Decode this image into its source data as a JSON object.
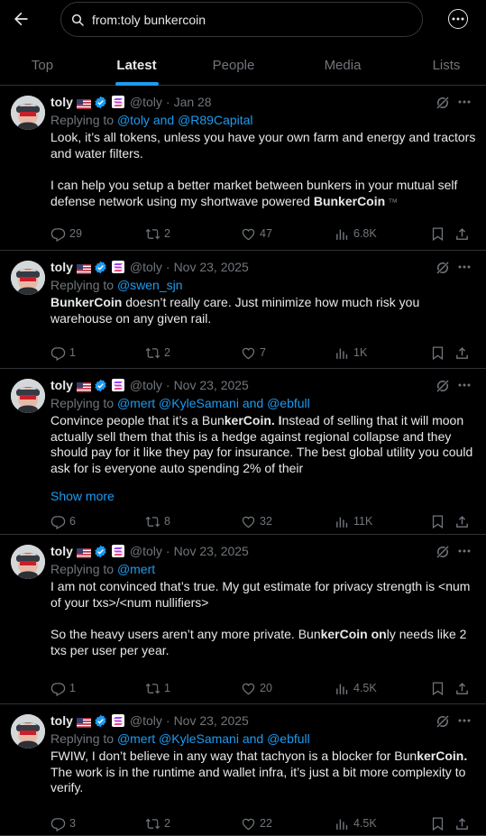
{
  "search": {
    "query": "from:toly bunkercoin"
  },
  "tabs": [
    {
      "label": "Top"
    },
    {
      "label": "Latest"
    },
    {
      "label": "People"
    },
    {
      "label": "Media"
    },
    {
      "label": "Lists"
    }
  ],
  "active_tab": "Latest",
  "icons": {
    "back": "arrow-left-icon",
    "search": "search-icon",
    "more": "more-circle-icon",
    "verified": "verified-badge-icon",
    "grok": "grok-icon",
    "reply": "reply-icon",
    "retweet": "retweet-icon",
    "like": "heart-icon",
    "views": "views-icon",
    "bookmark": "bookmark-icon",
    "share": "share-icon"
  },
  "colors": {
    "accent": "#1d9bf0",
    "background": "#000000",
    "muted": "#71767b",
    "text": "#e7e9ea"
  },
  "tweets": [
    {
      "name": "toly",
      "handle": "@toly",
      "sep": "·",
      "date": "Jan 28",
      "replying_prefix": "Replying to ",
      "replying_to": "@toly and @R89Capital",
      "paragraphs": [
        {
          "text": "Look, it’s all tokens, unless you have your own farm and energy and tractors and water filters."
        },
        {
          "text": ""
        },
        {
          "text": "I can help you setup a better market between bunkers in your mutual self defense network using my shortwave powered ",
          "bold": "BunkerCoin",
          "after": " ™"
        }
      ],
      "stats": {
        "replies": "29",
        "reposts": "2",
        "likes": "47",
        "views": "6.8K"
      }
    },
    {
      "name": "toly",
      "handle": "@toly",
      "sep": "·",
      "date": "Nov 23, 2025",
      "replying_prefix": "Replying to ",
      "replying_to": "@swen_sjn",
      "paragraphs": [
        {
          "bold_lead": "BunkerCoin",
          "text": " doesn’t really care. Just minimize how much risk you warehouse on any given rail."
        }
      ],
      "stats": {
        "replies": "1",
        "reposts": "2",
        "likes": "7",
        "views": "1K"
      }
    },
    {
      "name": "toly",
      "handle": "@toly",
      "sep": "·",
      "date": "Nov 23, 2025",
      "replying_prefix": "Replying to ",
      "replying_to": "@mert @KyleSamani and @ebfull",
      "paragraphs": [
        {
          "text": "Convince people that it’s a Bun",
          "bold": "kerCoin. I",
          "after": "nstead of selling that it will moon actually sell them that this is a hedge against regional collapse and they should pay for it like they pay for insurance.  The best global utility you could ask for is everyone auto spending 2% of their"
        }
      ],
      "show_more": "Show more",
      "stats": {
        "replies": "6",
        "reposts": "8",
        "likes": "32",
        "views": "11K"
      }
    },
    {
      "name": "toly",
      "handle": "@toly",
      "sep": "·",
      "date": "Nov 23, 2025",
      "replying_prefix": "Replying to ",
      "replying_to": "@mert",
      "paragraphs": [
        {
          "text": "I am not convinced that’s true.  My gut estimate for privacy strength is <num of your txs>/<num nullifiers>"
        },
        {
          "text": ""
        },
        {
          "text": "So the heavy users aren’t any more private.  Bun",
          "bold": "kerCoin on",
          "after": "ly needs like 2 txs per user per year."
        }
      ],
      "stats": {
        "replies": "1",
        "reposts": "1",
        "likes": "20",
        "views": "4.5K"
      }
    },
    {
      "name": "toly",
      "handle": "@toly",
      "sep": "·",
      "date": "Nov 23, 2025",
      "replying_prefix": "Replying to ",
      "replying_to": "@mert @KyleSamani and @ebfull",
      "paragraphs": [
        {
          "text": "FWIW, I don’t believe in any way that tachyon is a blocker for Bun",
          "bold": "kerCoin.",
          "after": " The work is in the runtime and wallet infra, it’s just a bit more complexity to verify."
        }
      ],
      "stats": {
        "replies": "3",
        "reposts": "2",
        "likes": "22",
        "views": "4.5K"
      }
    }
  ]
}
